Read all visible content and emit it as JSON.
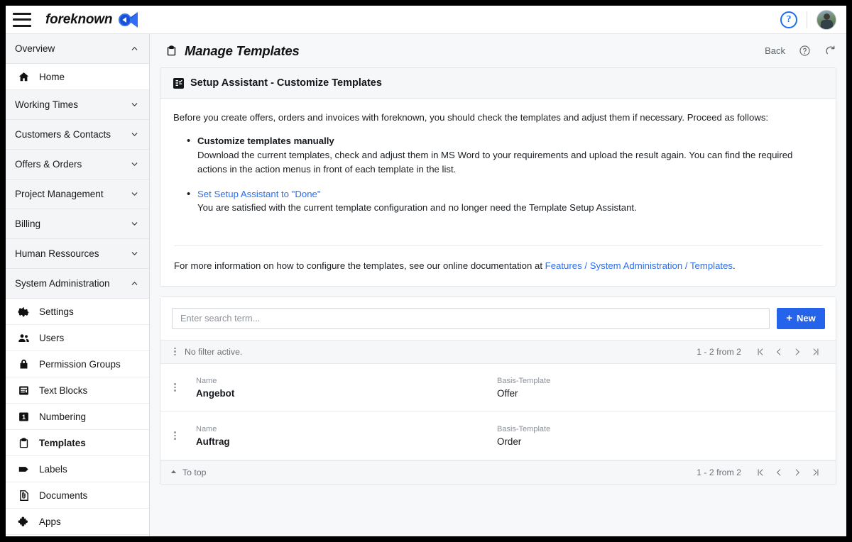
{
  "topbar": {
    "menu_icon": "hamburger-menu-icon",
    "brand_name": "foreknown",
    "brand_logo_icon": "foreknown-logo-icon",
    "help_icon": "help-circle-icon",
    "help_label": "?",
    "avatar_icon": "user-avatar"
  },
  "sidebar": {
    "groups": [
      {
        "label": "Overview",
        "icon": "chevron-up-icon",
        "expanded": true,
        "items": [
          {
            "label": "Home",
            "icon": "home-icon",
            "active": false
          }
        ]
      },
      {
        "label": "Working Times",
        "icon": "chevron-down-icon",
        "expanded": false,
        "items": []
      },
      {
        "label": "Customers & Contacts",
        "icon": "chevron-down-icon",
        "expanded": false,
        "items": []
      },
      {
        "label": "Offers & Orders",
        "icon": "chevron-down-icon",
        "expanded": false,
        "items": []
      },
      {
        "label": "Project Management",
        "icon": "chevron-down-icon",
        "expanded": false,
        "items": []
      },
      {
        "label": "Billing",
        "icon": "chevron-down-icon",
        "expanded": false,
        "items": []
      },
      {
        "label": "Human Ressources",
        "icon": "chevron-down-icon",
        "expanded": false,
        "items": []
      },
      {
        "label": "System Administration",
        "icon": "chevron-up-icon",
        "expanded": true,
        "items": [
          {
            "label": "Settings",
            "icon": "gear-icon",
            "active": false
          },
          {
            "label": "Users",
            "icon": "people-icon",
            "active": false
          },
          {
            "label": "Permission Groups",
            "icon": "lock-icon",
            "active": false
          },
          {
            "label": "Text Blocks",
            "icon": "article-icon",
            "active": false
          },
          {
            "label": "Numbering",
            "icon": "number-one-box-icon",
            "active": false
          },
          {
            "label": "Templates",
            "icon": "clipboard-icon",
            "active": true
          },
          {
            "label": "Labels",
            "icon": "tag-icon",
            "active": false
          },
          {
            "label": "Documents",
            "icon": "document-attachment-icon",
            "active": false
          },
          {
            "label": "Apps",
            "icon": "puzzle-piece-icon",
            "active": false
          }
        ]
      }
    ]
  },
  "page": {
    "title": "Manage Templates",
    "title_icon": "clipboard-icon",
    "back_label": "Back",
    "help_icon": "help-circle-icon",
    "refresh_icon": "refresh-icon"
  },
  "assistant": {
    "header_icon": "fact-check-icon",
    "header_title": "Setup Assistant - Customize Templates",
    "lede": "Before you create offers, orders and invoices with foreknown, you should check the templates and adjust them if necessary. Proceed as follows:",
    "steps": [
      {
        "title": "Customize templates manually",
        "is_link": false,
        "desc": "Download the current templates, check and adjust them in MS Word to your requirements and upload the result again. You can find the required actions in the action menus in front of each template in the list."
      },
      {
        "title": "Set Setup Assistant to \"Done\"",
        "is_link": true,
        "desc": "You are satisfied with the current template configuration and no longer need the Template Setup Assistant."
      }
    ],
    "footnote_prefix": "For more information on how to configure the templates, see our online documentation at ",
    "footnote_link": "Features / System Administration / Templates",
    "footnote_suffix": "."
  },
  "toolbar": {
    "search_placeholder": "Enter search term...",
    "search_value": "",
    "new_label": "New",
    "new_icon": "plus-icon"
  },
  "filter_bar": {
    "kebab_icon": "more-vertical-icon",
    "label": "No filter active.",
    "page_count": "1 - 2 from 2",
    "first_icon": "first-page-icon",
    "prev_icon": "previous-page-icon",
    "next_icon": "next-page-icon",
    "last_icon": "last-page-icon"
  },
  "table": {
    "col_name_label": "Name",
    "col_basis_label": "Basis-Template",
    "rows": [
      {
        "kebab_icon": "more-vertical-icon",
        "name": "Angebot",
        "basis": "Offer"
      },
      {
        "kebab_icon": "more-vertical-icon",
        "name": "Auftrag",
        "basis": "Order"
      }
    ]
  },
  "foot_bar": {
    "to_top_icon": "arrow-up-icon",
    "to_top_label": "To top",
    "page_count": "1 - 2 from 2",
    "first_icon": "first-page-icon",
    "prev_icon": "previous-page-icon",
    "next_icon": "next-page-icon",
    "last_icon": "last-page-icon"
  },
  "colors": {
    "accent_blue": "#2563eb",
    "link_blue": "#2a6ff0",
    "logo_blue": "#1b5ce0",
    "sidebar_section_bg": "#f4f5f7",
    "main_bg": "#f7f8f9"
  }
}
